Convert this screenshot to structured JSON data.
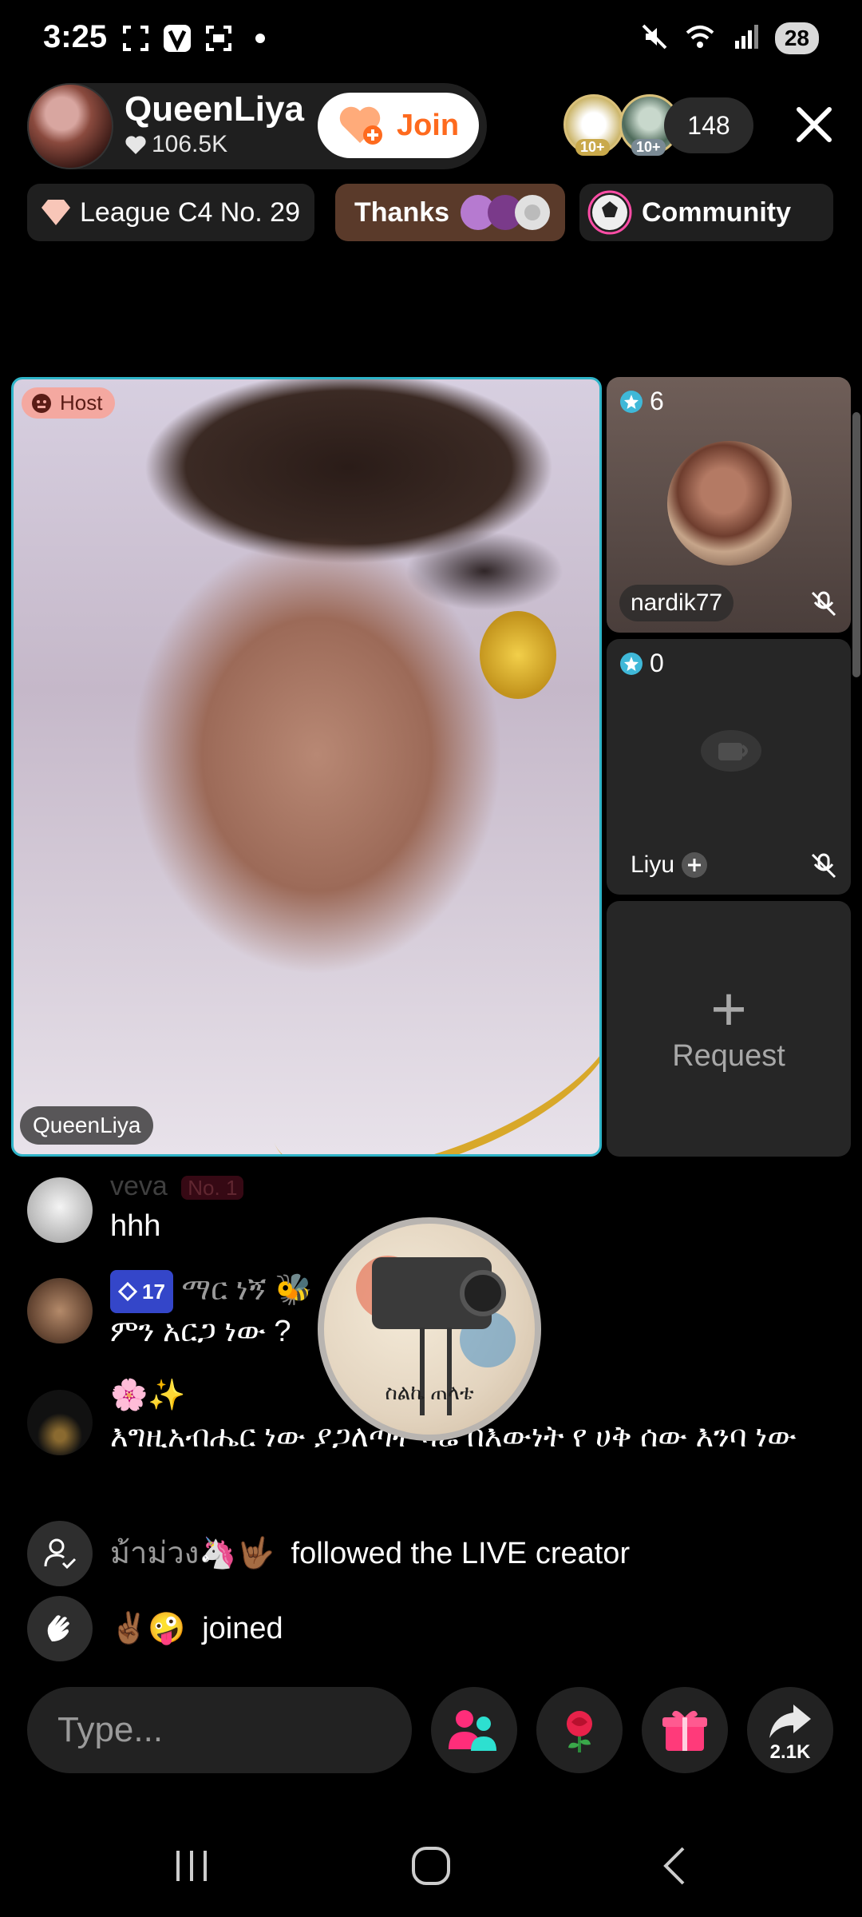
{
  "status_bar": {
    "time": "3:25",
    "battery": "28",
    "icons": [
      "screenshot-icon",
      "v-app-icon",
      "scan-icon",
      "dot-icon",
      "mute-icon",
      "wifi-icon",
      "signal-icon"
    ]
  },
  "header": {
    "host_name": "QueenLiya",
    "host_likes": "106.5K",
    "join_label": "Join",
    "viewer_badges": [
      "10+",
      "10+"
    ],
    "viewer_count": "148"
  },
  "tags": {
    "league": "League C4 No. 29",
    "thanks": "Thanks",
    "community": "Community"
  },
  "grid": {
    "host_badge": "Host",
    "host_label": "QueenLiya",
    "guests": [
      {
        "score": "6",
        "name": "nardik77"
      },
      {
        "score": "0",
        "name": "Liyu"
      }
    ],
    "request_label": "Request"
  },
  "chat": {
    "messages": [
      {
        "user": "veva",
        "rank": "No. 1",
        "text": "hhh"
      },
      {
        "level": "17",
        "user": "ማር ነኝ 🐝",
        "text": "ምን አርጋ ነው ?"
      },
      {
        "user": "🌸✨",
        "text": "እግዚአብሔር ነው ያጋለጣት ዛሬ በእውነት የ ሀቅ ሰው እንባ ነው"
      }
    ],
    "events": [
      {
        "user": "ม้าม่วง🦄🤟🏾",
        "text": "followed the LIVE creator"
      },
      {
        "user": "✌🏾🤪",
        "text": "joined"
      }
    ],
    "floating_badge_text": "ስልኬ ጠላቴ"
  },
  "input": {
    "placeholder": "Type...",
    "share_count": "2.1K"
  },
  "colors": {
    "accent_join": "#fe6a1e",
    "host_border": "#2fb4c8",
    "level_badge": "#3446c9"
  }
}
